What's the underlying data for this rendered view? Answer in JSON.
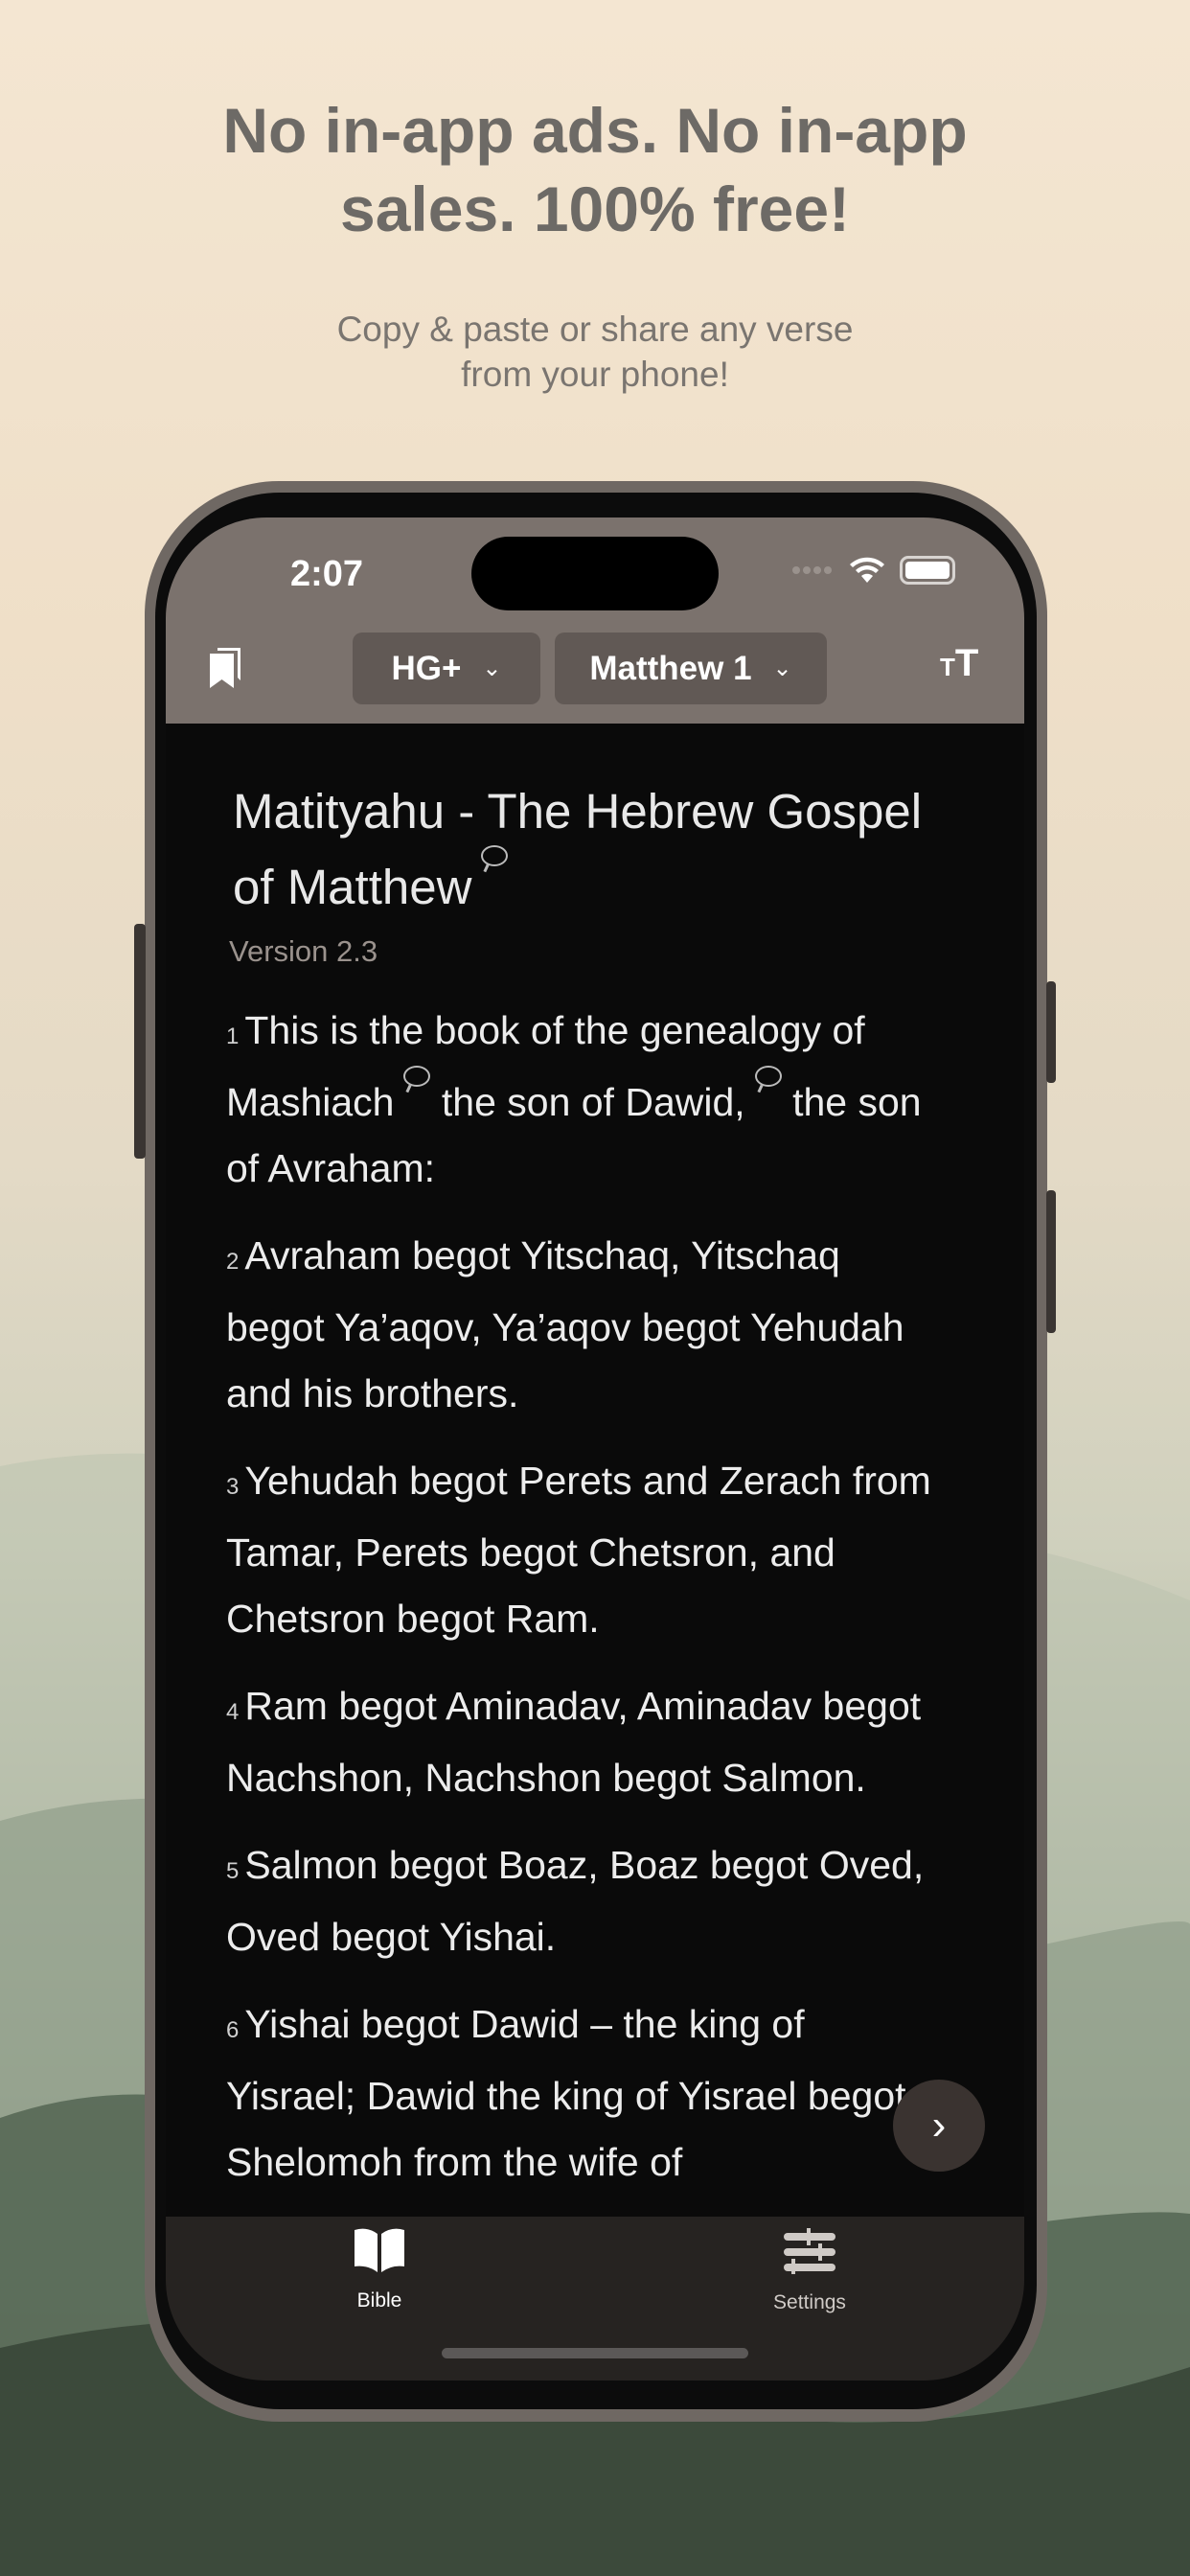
{
  "promo": {
    "headline": "No in-app ads. No in-app sales. 100% free!",
    "subtitle": "Copy & paste or share any verse from your phone!"
  },
  "status_bar": {
    "time": "2:07"
  },
  "toolbar": {
    "translation": "HG+",
    "chapter": "Matthew 1"
  },
  "content": {
    "title": "Matityahu - The Hebrew Gospel of Matthew",
    "version": "Version 2.3",
    "verses": [
      {
        "num": "1",
        "text": "This is the book of the genealogy of Mashiach",
        "text2": " the son of Dawid,",
        "text3": "  the son of Avraham:"
      },
      {
        "num": "2",
        "text": "Avraham begot Yitschaq, Yitschaq begot Ya’aqov, Ya’aqov begot Yehudah and his brothers."
      },
      {
        "num": "3",
        "text": "Yehudah begot Perets and Zerach from Tamar, Perets begot Chetsron, and Chetsron begot Ram."
      },
      {
        "num": "4",
        "text": "Ram begot Aminadav, Aminadav begot Nachshon, Nachshon begot Salmon."
      },
      {
        "num": "5",
        "text": "Salmon begot Boaz, Boaz begot Oved, Oved begot Yishai."
      },
      {
        "num": "6",
        "text": "Yishai begot Dawid – the king of Yisrael; Dawid the king of Yisrael begot Shelomoh from the wife of"
      }
    ]
  },
  "tabs": [
    {
      "label": "Bible",
      "active": true
    },
    {
      "label": "Settings",
      "active": false
    }
  ],
  "colors": {
    "header": "#7b726d",
    "content_bg": "#0a0a0a",
    "tabbar": "#262321"
  }
}
